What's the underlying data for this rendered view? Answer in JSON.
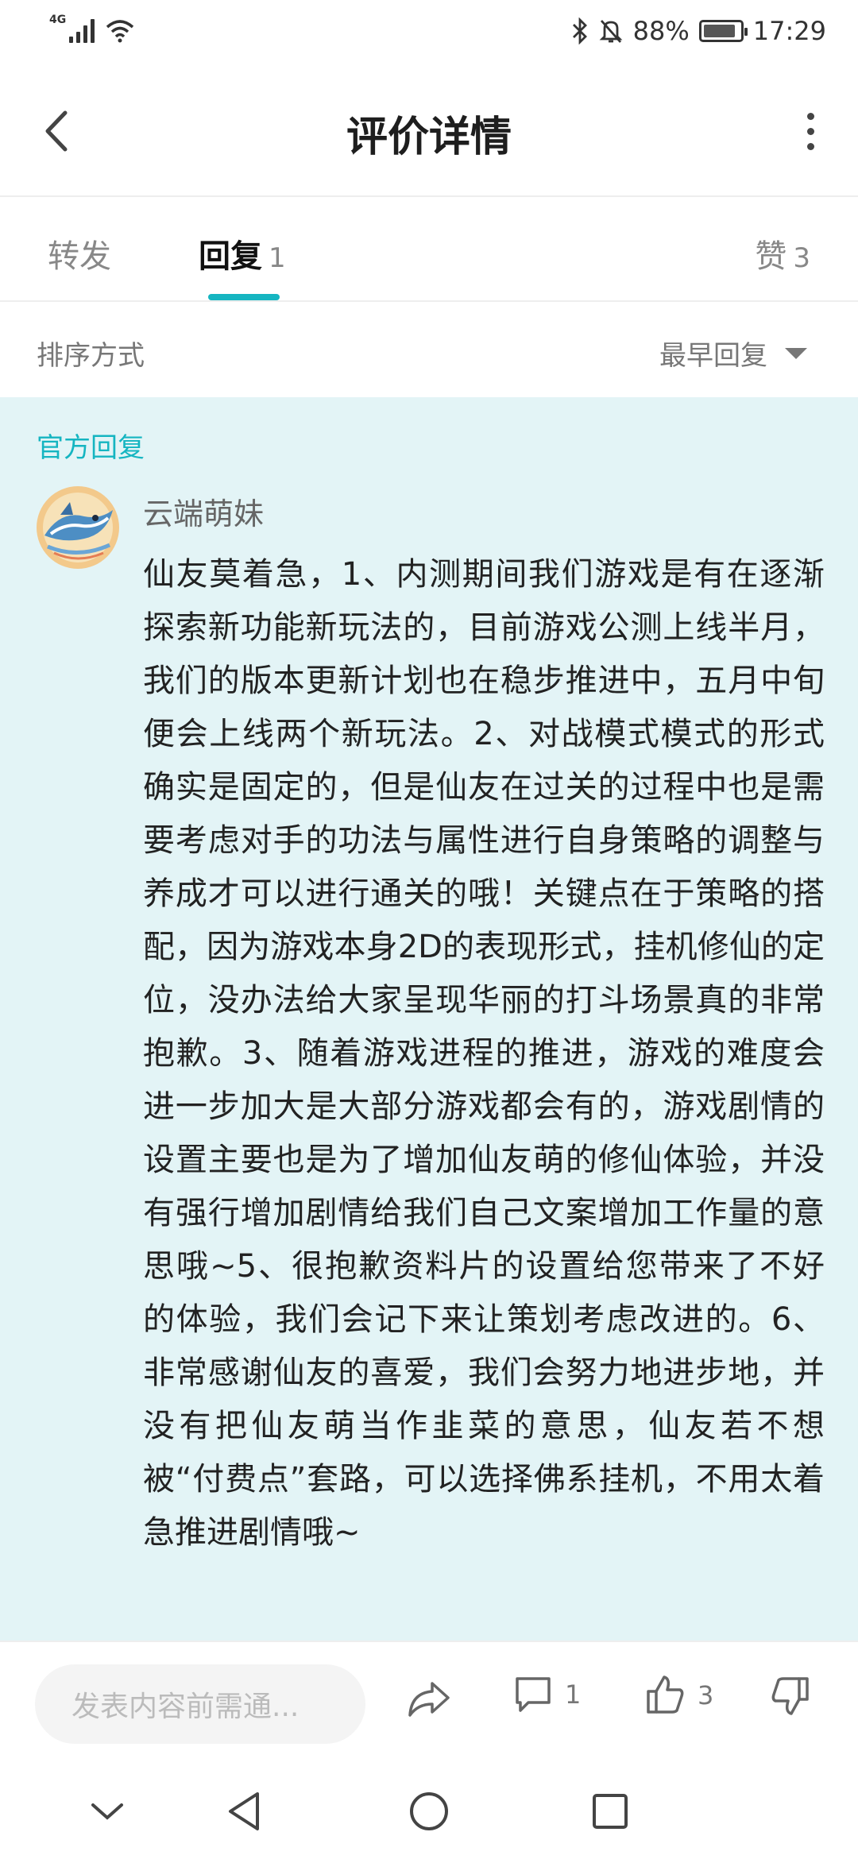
{
  "status_bar": {
    "network": "4G",
    "battery": "88%",
    "battery_level": 0.88,
    "time": "17:29",
    "icons": [
      "signal-icon",
      "wifi-icon",
      "bluetooth-icon",
      "mute-icon",
      "battery-icon"
    ]
  },
  "header": {
    "title": "评价详情"
  },
  "tabs": [
    {
      "label": "转发",
      "count": ""
    },
    {
      "label": "回复",
      "count": "1",
      "active": true
    },
    {
      "label": "赞",
      "count": "3"
    }
  ],
  "sort": {
    "label": "排序方式",
    "selected": "最早回复"
  },
  "reply": {
    "section_label": "官方回复",
    "author": "云端萌妹",
    "text": "仙友莫着急，1、内测期间我们游戏是有在逐渐探索新功能新玩法的，目前游戏公测上线半月，我们的版本更新计划也在稳步推进中，五月中旬便会上线两个新玩法。2、对战模式模式的形式确实是固定的，但是仙友在过关的过程中也是需要考虑对手的功法与属性进行自身策略的调整与养成才可以进行通关的哦！关键点在于策略的搭配，因为游戏本身2D的表现形式，挂机修仙的定位，没办法给大家呈现华丽的打斗场景真的非常抱歉。3、随着游戏进程的推进，游戏的难度会进一步加大是大部分游戏都会有的，游戏剧情的设置主要也是为了增加仙友萌的修仙体验，并没有强行增加剧情给我们自己文案增加工作量的意思哦~5、很抱歉资料片的设置给您带来了不好的体验，我们会记下来让策划考虑改进的。6、非常感谢仙友的喜爱，我们会努力地进步地，并没有把仙友萌当作韭菜的意思，仙友若不想被“付费点”套路，可以选择佛系挂机，不用太着急推进剧情哦~"
  },
  "action_bar": {
    "compose_placeholder": "发表内容前需通...",
    "comment_count": "1",
    "like_count": "3"
  },
  "colors": {
    "accent": "#15b5c1",
    "reply_bg": "#e3f4f6"
  }
}
